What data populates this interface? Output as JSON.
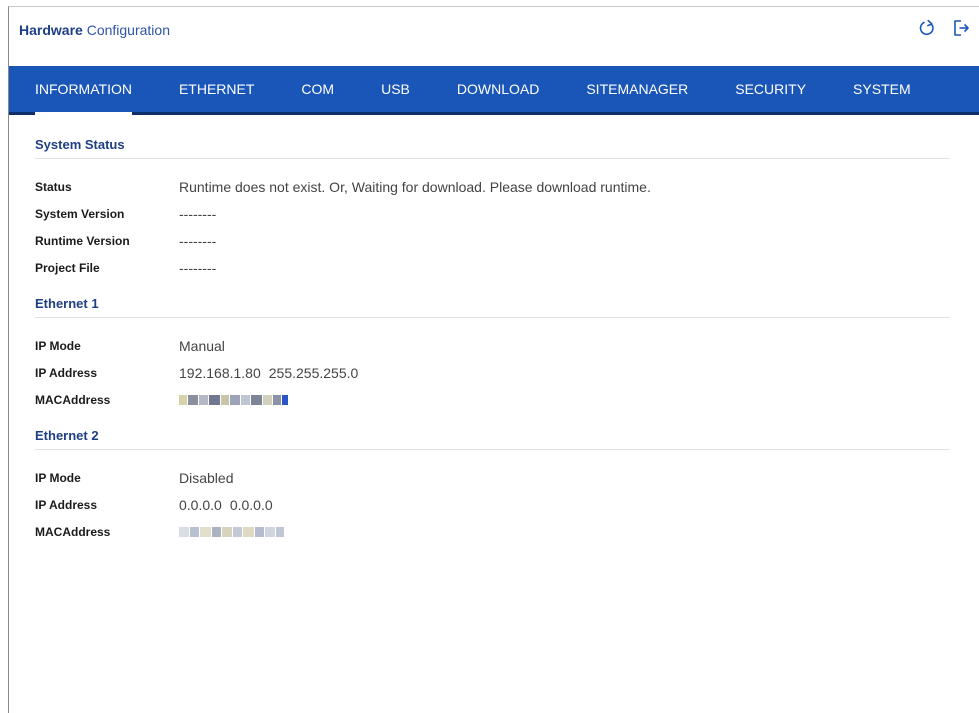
{
  "header": {
    "title_bold": "Hardware",
    "title_rest": " Configuration",
    "icons": [
      "power-icon",
      "logout-icon"
    ]
  },
  "nav": {
    "tabs": [
      {
        "label": "INFORMATION",
        "active": true
      },
      {
        "label": "ETHERNET",
        "active": false
      },
      {
        "label": "COM",
        "active": false
      },
      {
        "label": "USB",
        "active": false
      },
      {
        "label": "DOWNLOAD",
        "active": false
      },
      {
        "label": "SITEMANAGER",
        "active": false
      },
      {
        "label": "SECURITY",
        "active": false
      },
      {
        "label": "SYSTEM",
        "active": false
      }
    ]
  },
  "system_status": {
    "title": "System Status",
    "rows": [
      {
        "label": "Status",
        "value": "Runtime does not exist. Or, Waiting for download. Please download runtime."
      },
      {
        "label": "System Version",
        "value": "--------"
      },
      {
        "label": "Runtime Version",
        "value": "--------"
      },
      {
        "label": "Project File",
        "value": "--------"
      }
    ]
  },
  "ethernet1": {
    "title": "Ethernet 1",
    "ip_mode_label": "IP Mode",
    "ip_mode": "Manual",
    "ip_address_label": "IP Address",
    "ip_address": "192.168.1.80",
    "subnet": "255.255.255.0",
    "mac_label": "MACAddress"
  },
  "ethernet2": {
    "title": "Ethernet 2",
    "ip_mode_label": "IP Mode",
    "ip_mode": "Disabled",
    "ip_address_label": "IP Address",
    "ip_address": "0.0.0.0",
    "subnet": "0.0.0.0",
    "mac_label": "MACAddress"
  },
  "colors": {
    "accent": "#1a56b8",
    "nav_border": "#0e2f6b",
    "heading": "#1f3f85"
  }
}
